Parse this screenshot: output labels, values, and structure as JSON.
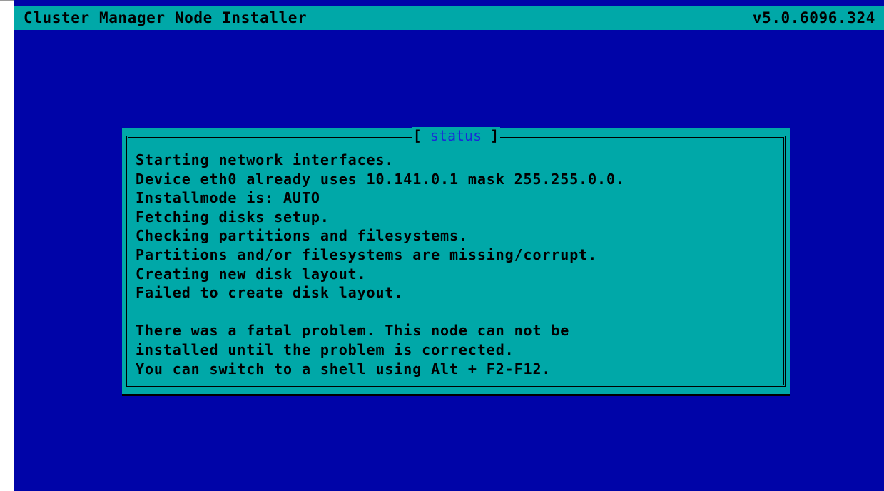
{
  "header": {
    "title": "Cluster Manager Node Installer",
    "version": "v5.0.6096.324"
  },
  "dialog": {
    "title": "status",
    "lines": [
      "Starting network interfaces.",
      "Device eth0 already uses 10.141.0.1 mask 255.255.0.0.",
      "Installmode is: AUTO",
      "Fetching disks setup.",
      "Checking partitions and filesystems.",
      "Partitions and/or filesystems are missing/corrupt.",
      "Creating new disk layout.",
      "Failed to create disk layout.",
      "",
      "There was a fatal problem. This node can not be",
      "installed until the problem is corrected.",
      "You can switch to a shell using Alt + F2-F12."
    ]
  },
  "colors": {
    "background": "#0004a8",
    "dialog": "#00a8a8",
    "titlebar": "#00a8a8",
    "text": "#000000",
    "dialog_title": "#1a2ad8"
  }
}
